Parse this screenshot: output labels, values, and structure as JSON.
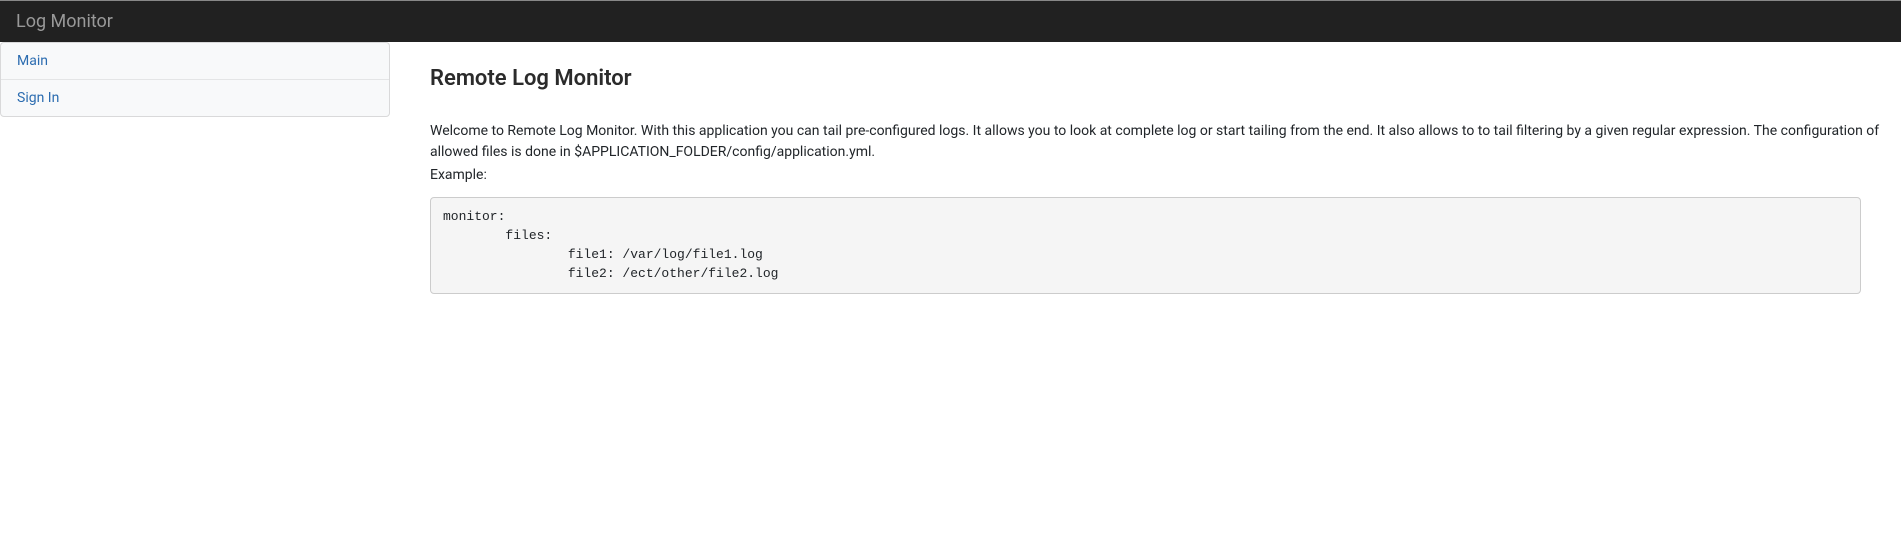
{
  "navbar": {
    "brand": "Log Monitor"
  },
  "sidebar": {
    "items": [
      {
        "label": "Main"
      },
      {
        "label": "Sign In"
      }
    ]
  },
  "main": {
    "title": "Remote Log Monitor",
    "description": "Welcome to Remote Log Monitor. With this application you can tail pre-configured logs. It allows you to look at complete log or start tailing from the end. It also allows to to tail filtering by a given regular expression. The configuration of allowed files is done in $APPLICATION_FOLDER/config/application.yml.",
    "example_label": "Example:",
    "code": "monitor:\n        files:\n                file1: /var/log/file1.log\n                file2: /ect/other/file2.log"
  }
}
